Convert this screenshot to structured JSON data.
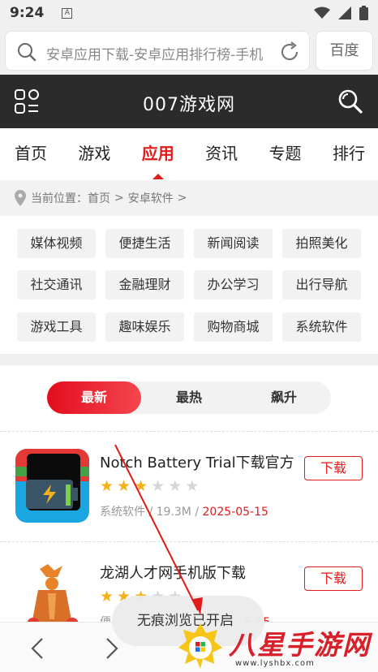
{
  "status_bar": {
    "time": "9:24",
    "app_indicator": "A"
  },
  "browser": {
    "url_text": "安卓应用下载-安卓应用排行榜-手机",
    "search_button": "百度"
  },
  "site": {
    "title": "007游戏网"
  },
  "nav": {
    "items": [
      {
        "label": "首页"
      },
      {
        "label": "游戏"
      },
      {
        "label": "应用",
        "active": true
      },
      {
        "label": "资讯"
      },
      {
        "label": "专题"
      },
      {
        "label": "排行"
      }
    ]
  },
  "breadcrumb": {
    "prefix": "当前位置：",
    "items": [
      "首页",
      ">",
      "安卓软件",
      ">"
    ]
  },
  "categories": [
    "媒体视频",
    "便捷生活",
    "新闻阅读",
    "拍照美化",
    "社交通讯",
    "金融理财",
    "办公学习",
    "出行导航",
    "游戏工具",
    "趣味娱乐",
    "购物商城",
    "系统软件"
  ],
  "tabs": [
    {
      "label": "最新",
      "active": true
    },
    {
      "label": "最热"
    },
    {
      "label": "飙升"
    }
  ],
  "apps": [
    {
      "name": "Notch Battery Trial下载官方",
      "rating": 3,
      "max_rating": 5,
      "category": "系统软件",
      "size": "19.3M",
      "date": "2025-05-15",
      "download_label": "下载"
    },
    {
      "name": "龙湖人才网手机版下载",
      "rating": 3,
      "max_rating": 5,
      "category": "便",
      "size": "",
      "date": "5-15",
      "download_label": "下载"
    }
  ],
  "toast": {
    "text": "无痕浏览已开启"
  },
  "watermark": {
    "text": "八星手游网",
    "url": "www.lyshbx.com"
  },
  "colors": {
    "accent": "#e21a1a",
    "header_bg": "#2b2b2b",
    "star": "#f6b11a"
  }
}
